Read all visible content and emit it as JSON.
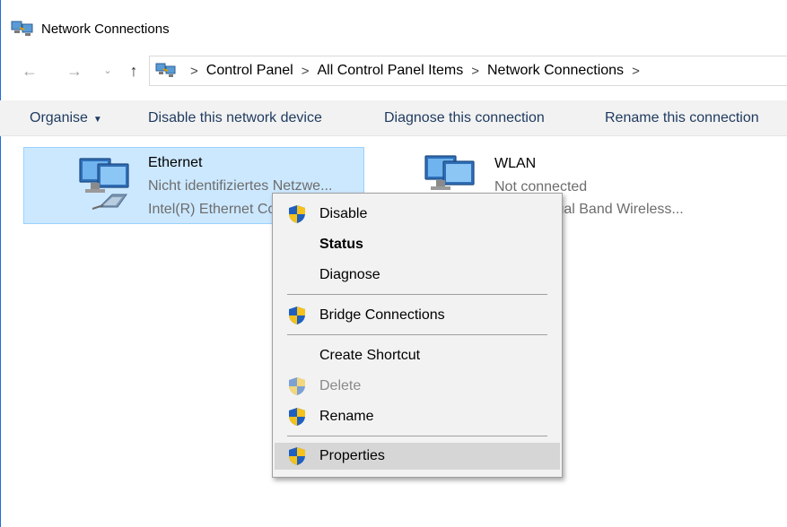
{
  "window": {
    "title": "Network Connections"
  },
  "nav": {
    "back": "←",
    "forward": "→",
    "recent": "⌄",
    "up": "↑"
  },
  "breadcrumbs": [
    "Control Panel",
    "All Control Panel Items",
    "Network Connections"
  ],
  "crumb_separator": ">",
  "toolbar": {
    "organise": "Organise",
    "disable": "Disable this network device",
    "diagnose": "Diagnose this connection",
    "rename": "Rename this connection"
  },
  "connections": [
    {
      "name": "Ethernet",
      "status": "Nicht identifiziertes Netzwe...",
      "adapter": "Intel(R) Ethernet Connection",
      "selected": true
    },
    {
      "name": "WLAN",
      "status": "Not connected",
      "adapter": "Intel(R) Dual Band Wireless...",
      "selected": false
    }
  ],
  "context_menu": {
    "disable": "Disable",
    "status": "Status",
    "diagnose": "Diagnose",
    "bridge": "Bridge Connections",
    "shortcut": "Create Shortcut",
    "delete": "Delete",
    "rename": "Rename",
    "properties": "Properties"
  },
  "colors": {
    "selection_fill": "#cce8ff",
    "selection_border": "#99d1ff",
    "menu_bg": "#f2f2f2",
    "menu_hover": "#d6d6d6",
    "toolbar_bg": "#f2f2f2",
    "shield_blue": "#1f5fbf",
    "shield_yellow": "#f5c21b"
  },
  "icons": [
    "network-connections-icon",
    "ethernet-adapter-icon",
    "wireless-adapter-icon",
    "uac-shield-icon"
  ]
}
